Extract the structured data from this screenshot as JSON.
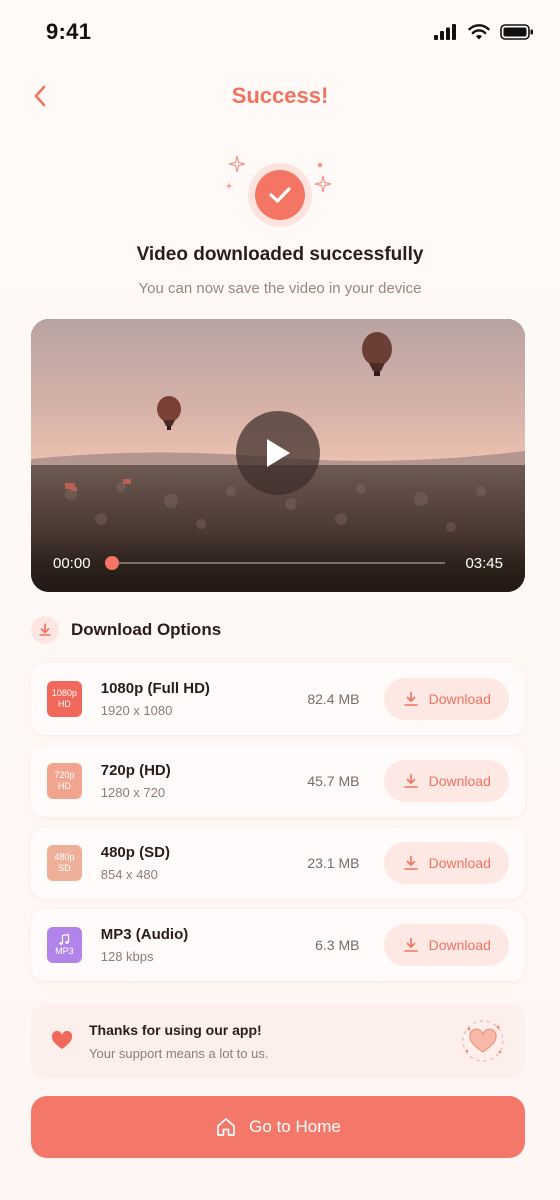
{
  "status_bar": {
    "time": "9:41"
  },
  "header": {
    "title": "Success!"
  },
  "success": {
    "title": "Video downloaded successfully",
    "subtitle": "You can now save the video in your device"
  },
  "video": {
    "current_time": "00:00",
    "duration": "03:45",
    "progress": 0.0
  },
  "download_options": {
    "heading": "Download Options",
    "items": [
      {
        "badge_top": "1080p",
        "badge_bottom": "HD",
        "title": "1080p (Full HD)",
        "resolution": "1920 x 1080",
        "size": "82.4 MB",
        "button_label": "Download",
        "badge_color": "#f1685a"
      },
      {
        "badge_top": "720p",
        "badge_bottom": "HD",
        "title": "720p (HD)",
        "resolution": "1280 x 720",
        "size": "45.7 MB",
        "button_label": "Download",
        "badge_color": "#f1a58e"
      },
      {
        "badge_top": "480p",
        "badge_bottom": "SD",
        "title": "480p (SD)",
        "resolution": "854 x 480",
        "size": "23.1 MB",
        "button_label": "Download",
        "badge_color": "#eeb099"
      },
      {
        "badge_top": "",
        "badge_bottom": "MP3",
        "title": "MP3 (Audio)",
        "resolution": "128 kbps",
        "size": "6.3 MB",
        "button_label": "Download",
        "badge_color": "#b184ea"
      }
    ]
  },
  "thanks": {
    "title": "Thanks for using our app!",
    "subtitle": "Your support means a lot to us."
  },
  "home_button": {
    "label": "Go to Home"
  },
  "colors": {
    "accent": "#f47564",
    "accent_light": "#fde8e3",
    "text_dark": "#2a1d1a"
  }
}
